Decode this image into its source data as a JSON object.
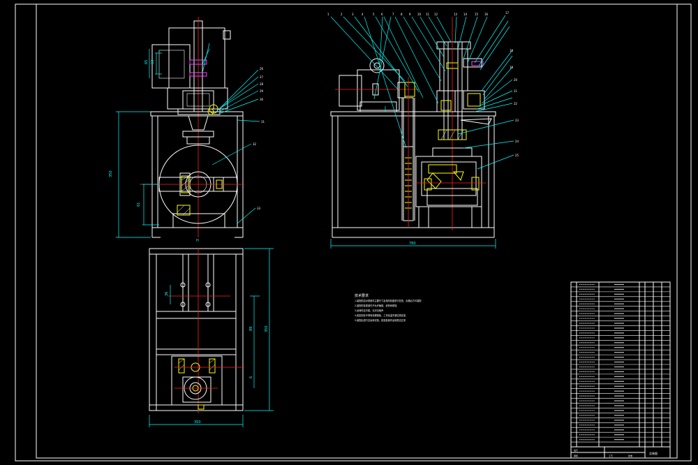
{
  "dimensions": {
    "front_height": "350",
    "front_width": "300",
    "side_width": "780",
    "top_width": "350",
    "top_height": "350",
    "left_small_h": "63",
    "left_small_h2": "65",
    "pump_h": "61",
    "top_left_h": "36",
    "top_right_a": "89",
    "top_right_b": "6"
  },
  "technical_requirements": {
    "heading": "技术要求",
    "lines": [
      "1.装配前应对零部件主要尺寸及相关精度进行复查，合格后方可装配",
      "2.装配时各零部件不允许磕碰、划伤和锈蚀",
      "3.运转时应平稳，无冲击噪声",
      "4.各密封处不得有渗漏现象，工作油温不超过规定值",
      "5.装配后进行空运转试验，检查各部件运转是否正常"
    ]
  },
  "title_block": {
    "drawing_name": "总装图",
    "footer_labels": [
      "设计",
      "审核",
      "工艺",
      "批准"
    ]
  }
}
